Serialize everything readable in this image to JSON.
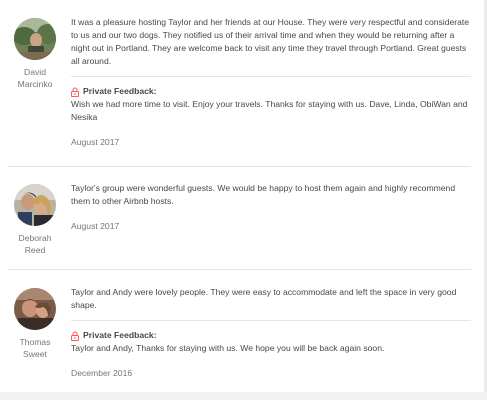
{
  "reviews": [
    {
      "name_first": "David",
      "name_last": "Marcinko",
      "avatar": "avatar-photo",
      "text": "It was a pleasure hosting Taylor and her friends at our House. They were very respectful and considerate to us and our two dogs. They notified us of their arrival time and when they would be returning after a night out in Portland. They are welcome back to visit any time they travel through Portland. Great guests all around.",
      "private_feedback_label": "Private Feedback:",
      "private_feedback_icon": "lock-icon",
      "private_feedback": "Wish we had more time to visit. Enjoy your travels. Thanks for staying with us. Dave, Linda, ObiWan and Nesika",
      "date": "August 2017"
    },
    {
      "name_first": "Deborah",
      "name_last": "Reed",
      "avatar": "avatar-photo",
      "text": "Taylor's group were wonderful guests. We would be happy to host them again and highly recommend them to other Airbnb hosts.",
      "date": "August 2017"
    },
    {
      "name_first": "Thomas",
      "name_last": "Sweet",
      "avatar": "avatar-photo",
      "text": "Taylor and Andy were lovely people. They were easy to accommodate and left the space in very good shape.",
      "private_feedback_label": "Private Feedback:",
      "private_feedback_icon": "lock-icon",
      "private_feedback": "Taylor and Andy, Thanks for staying with us. We hope you will be back again soon.",
      "date": "December 2016"
    }
  ],
  "colors": {
    "lock": "#ff5a5f",
    "text": "#484848",
    "muted": "#767676",
    "divider": "#e4e4e4"
  }
}
